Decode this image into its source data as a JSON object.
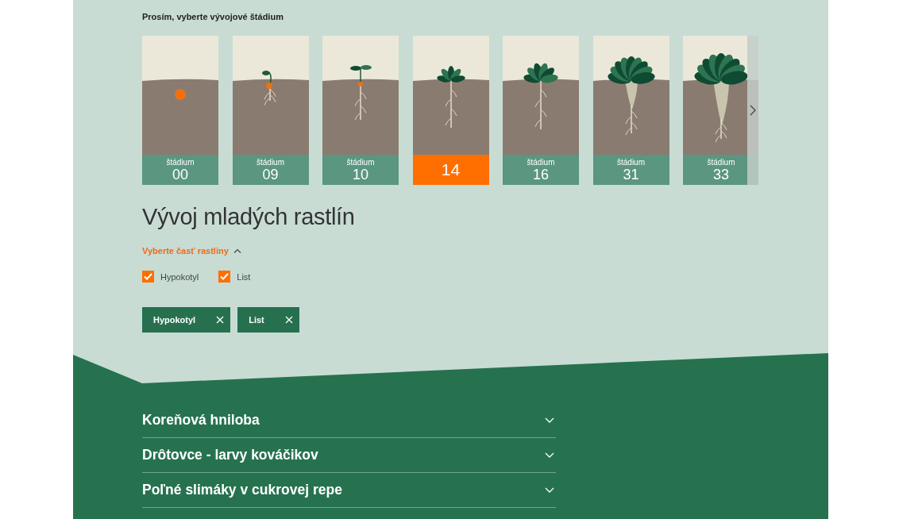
{
  "heading": "Prosím, vyberte vývojové štádium",
  "stages": [
    {
      "kind": "seed",
      "label": "štádium",
      "number": "00",
      "selected": false
    },
    {
      "kind": "germ",
      "label": "štádium",
      "number": "09",
      "selected": false
    },
    {
      "kind": "sprout",
      "label": "štádium",
      "number": "10",
      "selected": false
    },
    {
      "kind": "seedling",
      "number": "14",
      "selected": true
    },
    {
      "kind": "young",
      "label": "štádium",
      "number": "16",
      "selected": false
    },
    {
      "kind": "beet",
      "label": "štádium",
      "number": "31",
      "selected": false
    },
    {
      "kind": "bigbeet",
      "label": "štádium",
      "number": "33",
      "selected": false
    }
  ],
  "title": "Vývoj mladých rastlín",
  "part_filter": {
    "label": "Vyberte časť rastliny",
    "expanded": true,
    "options": [
      {
        "label": "Hypokotyl",
        "checked": true
      },
      {
        "label": "List",
        "checked": true
      }
    ]
  },
  "active_filters": [
    {
      "label": "Hypokotyl"
    },
    {
      "label": "List"
    }
  ],
  "accordion": [
    {
      "title": "Koreňová hniloba",
      "expanded": false
    },
    {
      "title": "Drôtovce - larvy kováčikov",
      "expanded": false
    },
    {
      "title": "Poľné slimáky v cukrovej repe",
      "expanded": false
    }
  ]
}
